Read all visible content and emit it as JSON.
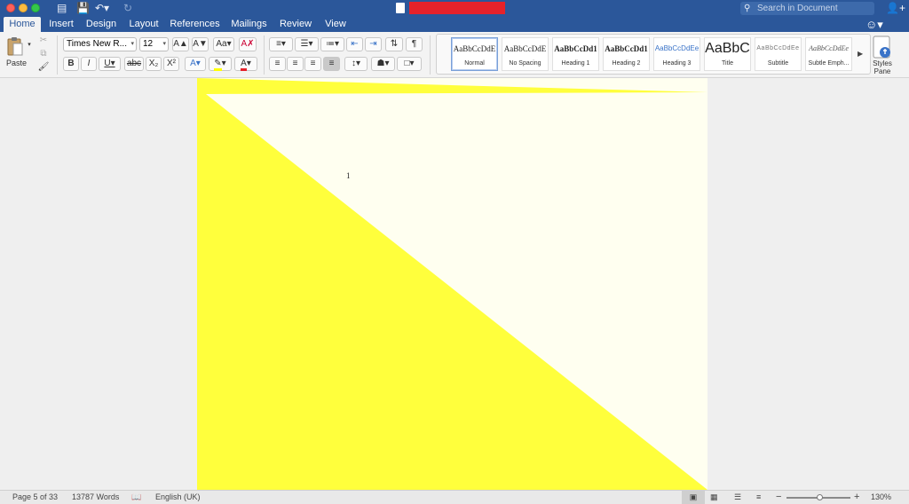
{
  "titlebar": {
    "doc_title": "",
    "search_placeholder": "Search in Document"
  },
  "tabs": [
    {
      "label": "Home",
      "active": true
    },
    {
      "label": "Insert"
    },
    {
      "label": "Design"
    },
    {
      "label": "Layout"
    },
    {
      "label": "References"
    },
    {
      "label": "Mailings"
    },
    {
      "label": "Review"
    },
    {
      "label": "View"
    }
  ],
  "ribbon": {
    "paste_label": "Paste",
    "font_name": "Times New R...",
    "font_size": "12",
    "styles": [
      {
        "sample": "AaBbCcDdE",
        "name": "Normal",
        "selected": true
      },
      {
        "sample": "AaBbCcDdE",
        "name": "No Spacing"
      },
      {
        "sample": "AaBbCcDd1",
        "name": "Heading 1"
      },
      {
        "sample": "AaBbCcDd1",
        "name": "Heading 2"
      },
      {
        "sample": "AaBbCcDdEe",
        "name": "Heading 3"
      },
      {
        "sample": "AaBbC",
        "name": "Title"
      },
      {
        "sample": "AaBbCcDdEe",
        "name": "Subtitle"
      },
      {
        "sample": "AaBbCcDdEe",
        "name": "Subtle Emph..."
      }
    ],
    "styles_pane_label": "Styles Pane"
  },
  "document": {
    "page_number": "1",
    "shape_fill": "#ffff3c",
    "page_fill": "#fffff0"
  },
  "statusbar": {
    "page": "Page 5 of 33",
    "words": "13787 Words",
    "language": "English (UK)",
    "zoom": "130%",
    "zoom_fraction": 0.53
  },
  "colors": {
    "accent": "#2b579a",
    "highlight": "#ffff00",
    "font_color": "#e5222a"
  }
}
